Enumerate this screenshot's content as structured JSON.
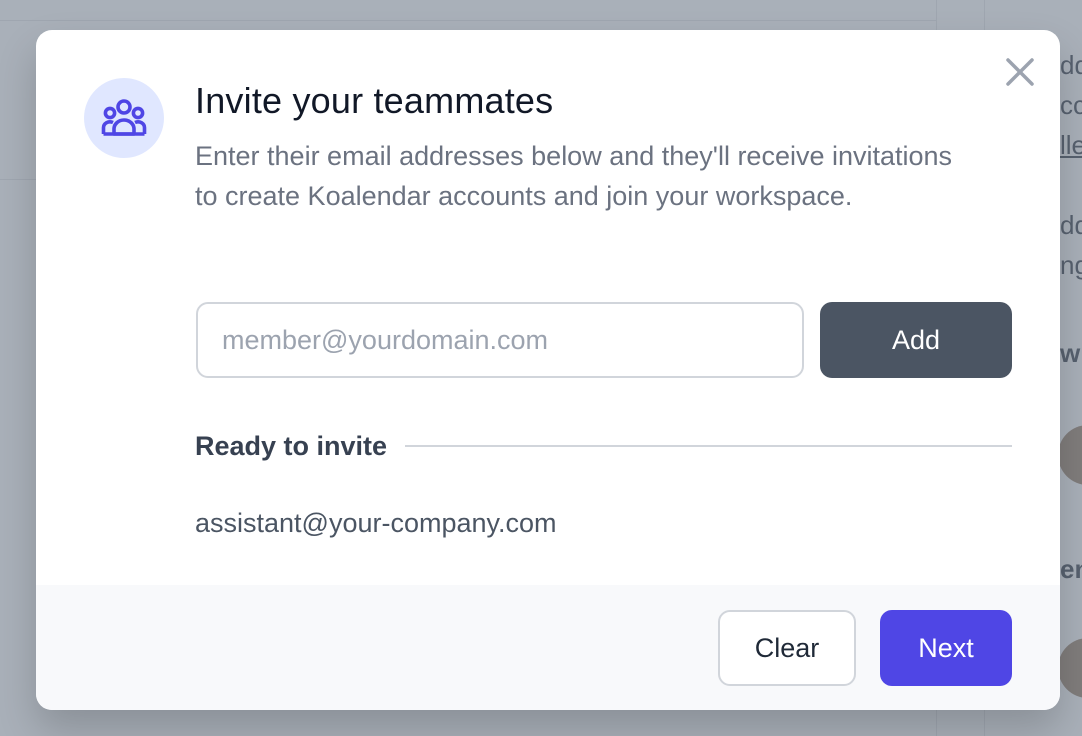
{
  "background": {
    "side_fragments": [
      "dd",
      "cc",
      "lle",
      "dd",
      "ng",
      "w",
      "en"
    ]
  },
  "modal": {
    "title": "Invite your teammates",
    "description": "Enter their email addresses below and they'll receive invitations to create Koalendar accounts and join your workspace.",
    "icon": "user-group-icon",
    "close_icon": "close-icon",
    "email_input": {
      "value": "",
      "placeholder": "member@yourdomain.com"
    },
    "add_label": "Add",
    "ready_section_label": "Ready to invite",
    "invitees": [
      "assistant@your-company.com"
    ],
    "clear_label": "Clear",
    "next_label": "Next"
  },
  "colors": {
    "accent": "#4f46e5",
    "icon_bg": "#e0e7ff",
    "add_button": "#4b5563"
  }
}
